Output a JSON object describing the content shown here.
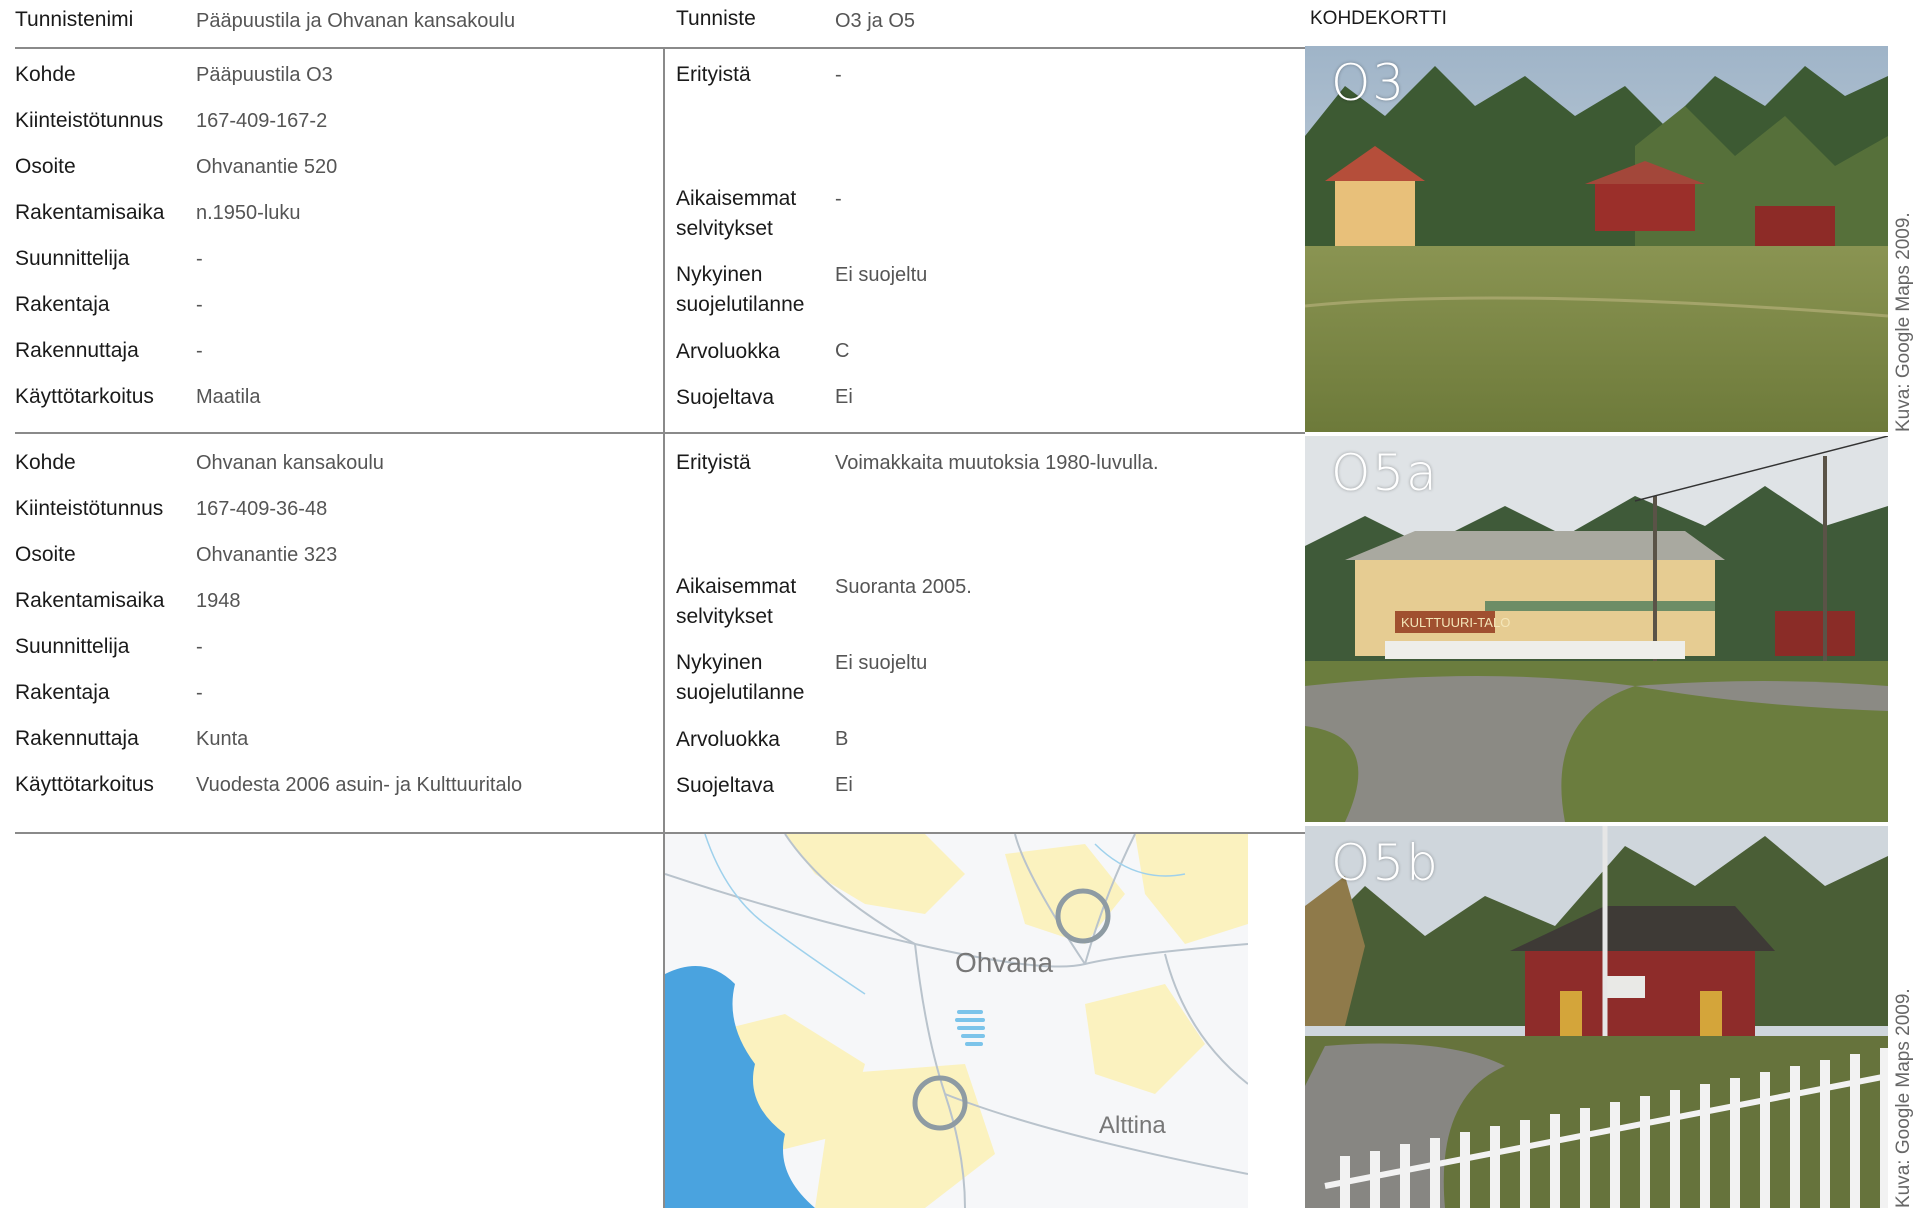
{
  "header": {
    "name_label": "Tunnistenimi",
    "name_value": "Pääpuustila ja Ohvanan kansakoulu",
    "id_label": "Tunniste",
    "id_value": "O3 ja O5",
    "card_title": "KOHDEKORTTI"
  },
  "sections": [
    {
      "left": [
        {
          "label": "Kohde",
          "value": "Pääpuustila O3"
        },
        {
          "label": "Kiinteistötunnus",
          "value": "167-409-167-2"
        },
        {
          "label": "Osoite",
          "value": "Ohvanantie 520"
        },
        {
          "label": "Rakentamisaika",
          "value": "n.1950-luku"
        },
        {
          "label": "Suunnittelija",
          "value": "-"
        },
        {
          "label": "Rakentaja",
          "value": "-"
        },
        {
          "label": "Rakennuttaja",
          "value": "-"
        },
        {
          "label": "Käyttötarkoitus",
          "value": "Maatila"
        }
      ],
      "right": [
        {
          "label": "Erityistä",
          "value": "-"
        },
        {
          "label": "Aikaisemmat selvitykset",
          "value": "-"
        },
        {
          "label": "Nykyinen suojelutilanne",
          "value": "Ei suojeltu"
        },
        {
          "label": "Arvoluokka",
          "value": "C"
        },
        {
          "label": "Suojeltava",
          "value": "Ei"
        }
      ]
    },
    {
      "left": [
        {
          "label": "Kohde",
          "value": "Ohvanan kansakoulu"
        },
        {
          "label": "Kiinteistötunnus",
          "value": "167-409-36-48"
        },
        {
          "label": "Osoite",
          "value": "Ohvanantie 323"
        },
        {
          "label": "Rakentamisaika",
          "value": "1948"
        },
        {
          "label": "Suunnittelija",
          "value": "-"
        },
        {
          "label": "Rakentaja",
          "value": "-"
        },
        {
          "label": "Rakennuttaja",
          "value": "Kunta"
        },
        {
          "label": "Käyttötarkoitus",
          "value": "Vuodesta 2006 asuin- ja Kulttuuritalo"
        }
      ],
      "right": [
        {
          "label": "Erityistä",
          "value": "Voimakkaita muutoksia 1980-luvulla."
        },
        {
          "label": "Aikaisemmat selvitykset",
          "value": "Suoranta 2005."
        },
        {
          "label": "Nykyinen suojelutilanne",
          "value": "Ei suojeltu"
        },
        {
          "label": "Arvoluokka",
          "value": "B"
        },
        {
          "label": "Suojeltava",
          "value": "Ei"
        }
      ]
    }
  ],
  "photos": [
    {
      "label": "O3"
    },
    {
      "label": "O5a",
      "sign": "KULTTUURI-TALO"
    },
    {
      "label": "O5b"
    }
  ],
  "captions": [
    "Kuva: Google Maps 2009.",
    "Kuva: Google Maps 2009."
  ],
  "map": {
    "place1": "Ohvana",
    "place2": "Alttina"
  }
}
